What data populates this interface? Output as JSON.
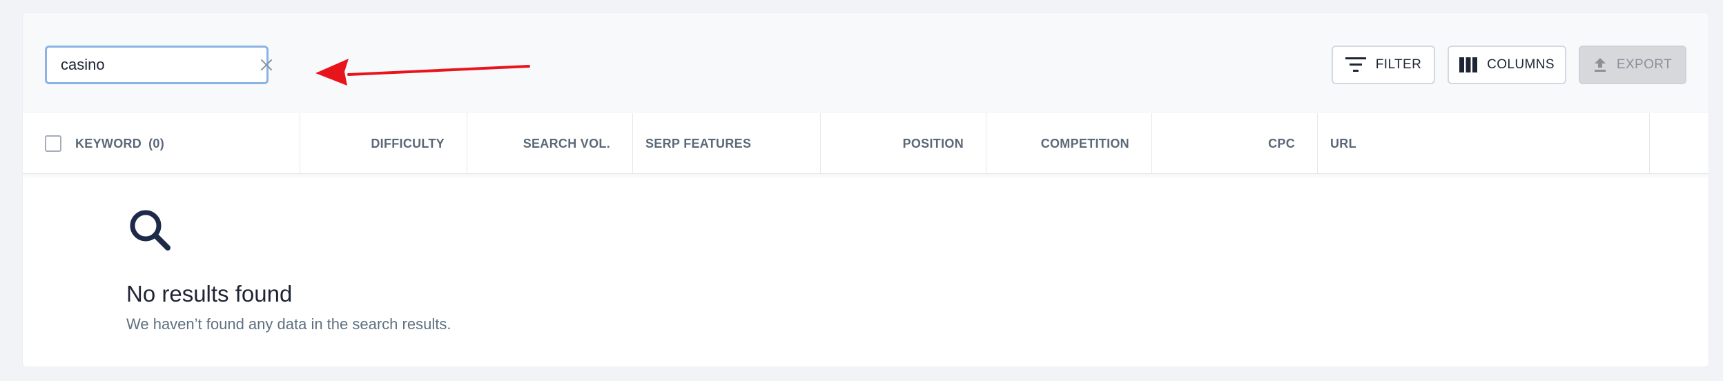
{
  "search": {
    "value": "casino",
    "placeholder": ""
  },
  "toolbar": {
    "filter_label": "FILTER",
    "columns_label": "COLUMNS",
    "export_label": "EXPORT"
  },
  "table": {
    "keyword_label": "KEYWORD",
    "keyword_count": "(0)",
    "columns": [
      "DIFFICULTY",
      "SEARCH VOL.",
      "SERP FEATURES",
      "POSITION",
      "COMPETITION",
      "CPC",
      "URL"
    ]
  },
  "empty_state": {
    "icon": "search-icon",
    "title": "No results found",
    "subtitle": "We haven’t found any data in the search results."
  },
  "colors": {
    "focus_border": "#8ab4e6",
    "annotation_arrow": "#e8141c",
    "text_dark": "#1d2433",
    "text_muted": "#5f7080",
    "export_disabled_bg": "#d6d8dc"
  }
}
